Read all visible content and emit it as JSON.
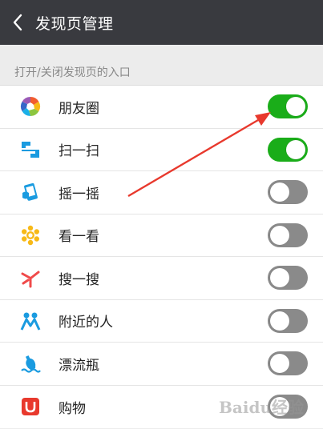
{
  "header": {
    "back_icon": "chevron-left-icon",
    "title": "发现页管理"
  },
  "section": {
    "label": "打开/关闭发现页的入口"
  },
  "colors": {
    "header_bg": "#393a3f",
    "toggle_on": "#1aad19",
    "toggle_off": "#8a8a8a",
    "annotation": "#e8392d"
  },
  "items": [
    {
      "label": "朋友圈",
      "icon": "moments-icon",
      "on": true
    },
    {
      "label": "扫一扫",
      "icon": "scan-icon",
      "on": true
    },
    {
      "label": "摇一摇",
      "icon": "shake-icon",
      "on": false
    },
    {
      "label": "看一看",
      "icon": "top-stories-icon",
      "on": false
    },
    {
      "label": "搜一搜",
      "icon": "search-icon",
      "on": false
    },
    {
      "label": "附近的人",
      "icon": "people-nearby-icon",
      "on": false
    },
    {
      "label": "漂流瓶",
      "icon": "drift-bottle-icon",
      "on": false
    },
    {
      "label": "购物",
      "icon": "shopping-icon",
      "on": false
    }
  ],
  "watermark": "Baidu经验"
}
